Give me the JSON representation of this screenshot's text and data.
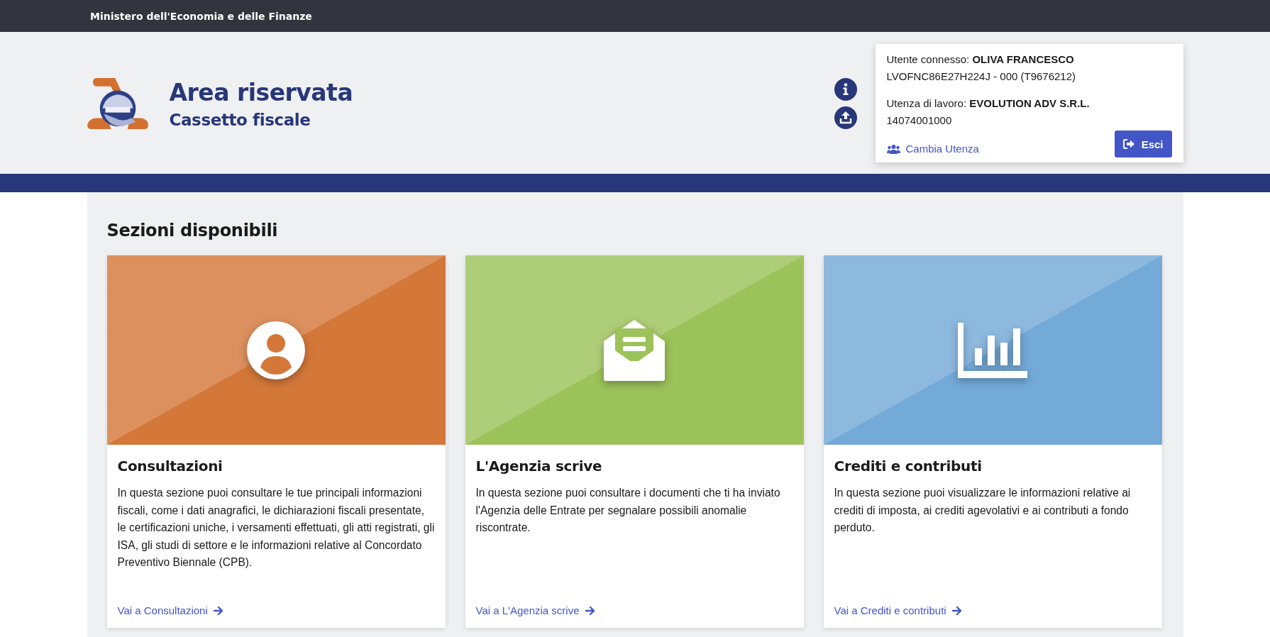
{
  "top_bar": {
    "title": "Ministero dell'Economia e delle Finanze"
  },
  "header": {
    "title": "Area riservata",
    "subtitle": "Cassetto fiscale"
  },
  "user_panel": {
    "user_line": "Utente connesso: **OLIVA FRANCESCO**",
    "user_code": "LVOFNC86E27H224J - 000 (T9676212)",
    "work_line": "Utenza di lavoro: **EVOLUTION ADV S.R.L.**",
    "work_code": "14074001000",
    "switch_link": "Cambia Utenza",
    "logout_button": "Esci"
  },
  "section_title": "Sezioni disponibili",
  "cards": [
    {
      "kind": "person",
      "color": "#d4783a",
      "title": "Consultazioni",
      "text": "In questa sezione puoi consultare le tue principali informazioni fiscali, come i dati anagrafici, le dichiarazioni fiscali presentate, le certificazioni uniche, i versamenti effettuati, gli atti registrati, gli ISA, gli studi di settore e le informazioni relative al Concordato Preventivo Biennale (CPB).",
      "link": "Vai a Consultazioni"
    },
    {
      "kind": "mail",
      "color": "#9cc25a",
      "title": "L'Agenzia scrive",
      "text": "In questa sezione puoi consultare i documenti che ti ha inviato l'Agenzia delle Entrate per segnalare possibili anomalie riscontrate.",
      "link": "Vai a L'Agenzia scrive"
    },
    {
      "kind": "chart",
      "color": "#74aad8",
      "title": "Crediti e contributi",
      "text": "In questa sezione puoi visualizzare le informazioni relative ai crediti di imposta, ai crediti agevolativi e ai contributi a fondo perduto.",
      "link": "Vai a Crediti e contributi"
    }
  ]
}
